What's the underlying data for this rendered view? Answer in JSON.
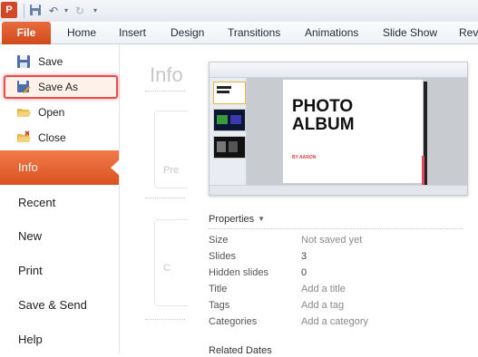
{
  "app": {
    "logo_letter": "P"
  },
  "quick_access": {
    "icons": [
      "save-icon",
      "undo-icon",
      "dropdown-icon",
      "redo-icon",
      "customize-icon"
    ]
  },
  "ribbon": {
    "file_tab": "File",
    "tabs": [
      "Home",
      "Insert",
      "Design",
      "Transitions",
      "Animations",
      "Slide Show",
      "Revi"
    ]
  },
  "backstage": {
    "menu_small": [
      {
        "label": "Save",
        "icon": "save-icon"
      },
      {
        "label": "Save As",
        "icon": "save-as-icon",
        "highlighted": true
      },
      {
        "label": "Open",
        "icon": "open-folder-icon"
      },
      {
        "label": "Close",
        "icon": "close-file-icon"
      }
    ],
    "menu_big": [
      "Info",
      "Recent",
      "New",
      "Print",
      "Save & Send",
      "Help"
    ],
    "active": "Info"
  },
  "middle_panel": {
    "title": "Info",
    "card_labels": [
      "Pre",
      "C"
    ]
  },
  "preview": {
    "slide_title_line1": "PHOTO",
    "slide_title_line2": "ALBUM",
    "slide_byline": "BY AARON"
  },
  "properties": {
    "header": "Properties",
    "rows": [
      {
        "key": "Size",
        "value": "Not saved yet",
        "muted": true
      },
      {
        "key": "Slides",
        "value": "3",
        "muted": false
      },
      {
        "key": "Hidden slides",
        "value": "0",
        "muted": false
      },
      {
        "key": "Title",
        "value": "Add a title",
        "muted": true
      },
      {
        "key": "Tags",
        "value": "Add a tag",
        "muted": true
      },
      {
        "key": "Categories",
        "value": "Add a category",
        "muted": true
      }
    ],
    "related_dates": "Related Dates"
  },
  "colors": {
    "file_tab": "#d9531f",
    "active_menu": "#e8683a",
    "highlight_border": "#e94d4d"
  }
}
